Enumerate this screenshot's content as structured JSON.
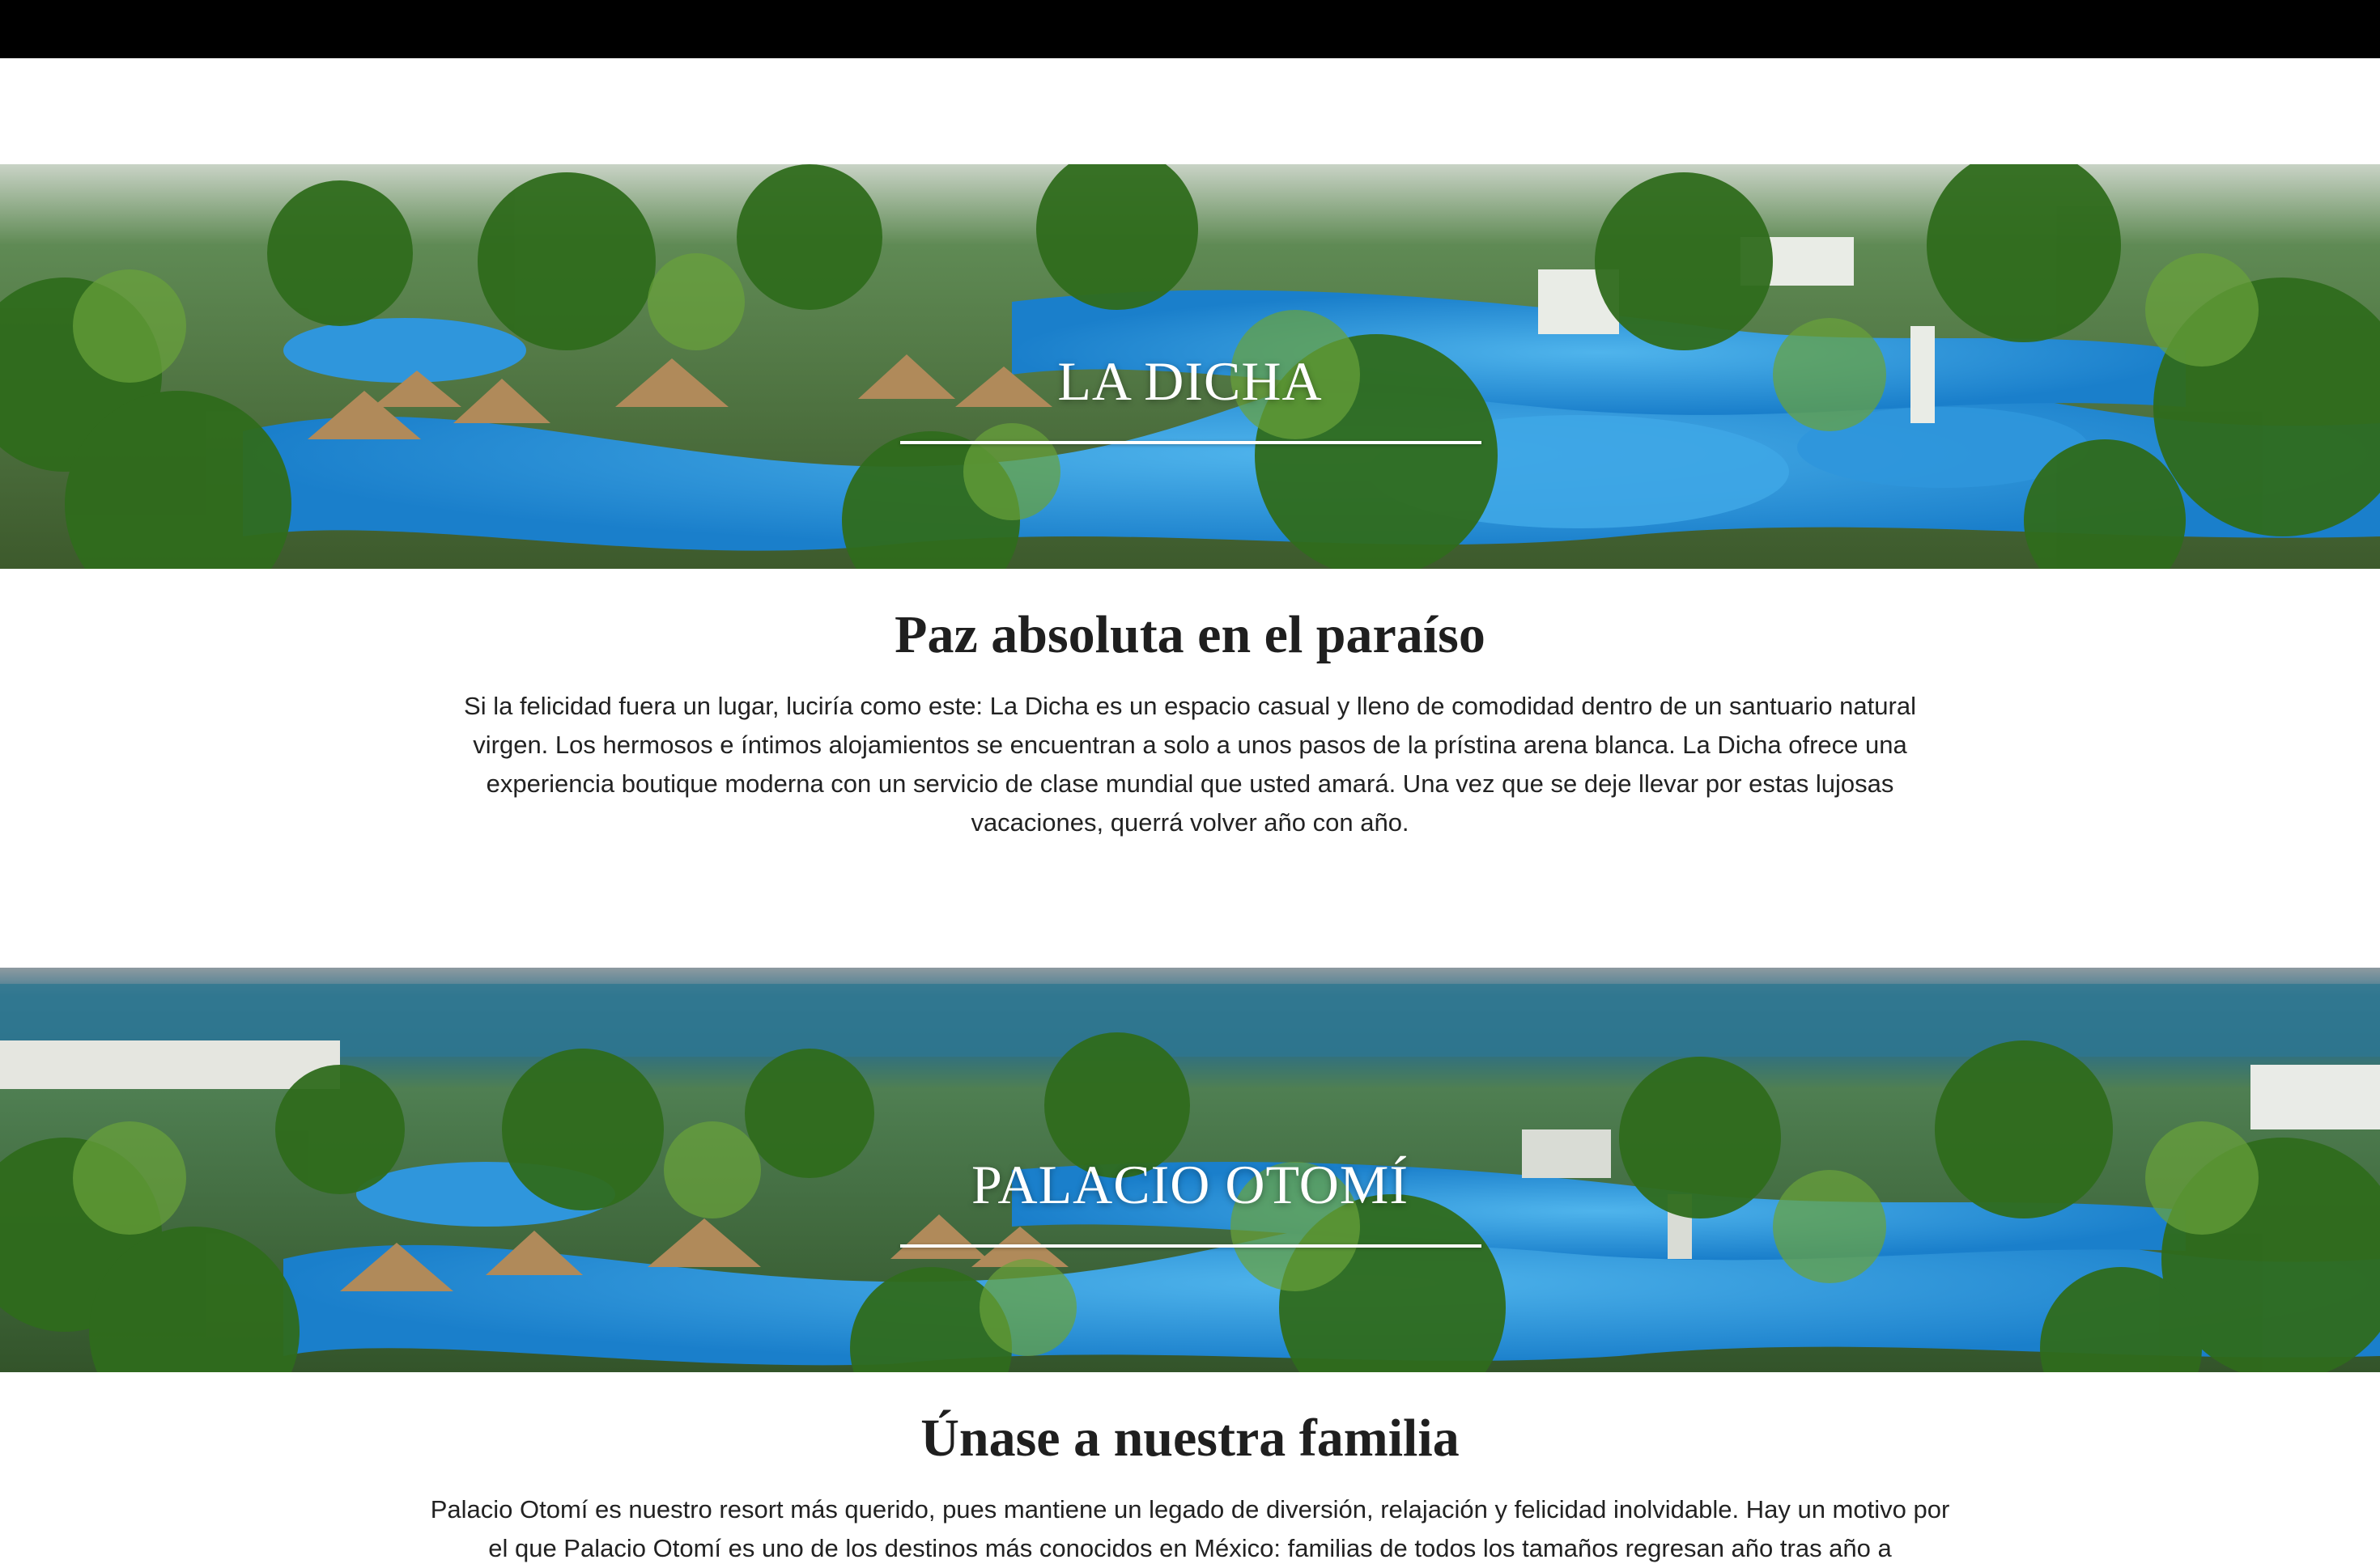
{
  "sections": [
    {
      "banner_title": "LA DICHA",
      "heading": "Paz absoluta en el paraíso",
      "body": "Si la felicidad fuera un lugar, luciría como este: La Dicha es un espacio casual y lleno de comodidad dentro de un santuario natural virgen. Los hermosos e íntimos alojamientos se encuentran a solo a unos pasos de la prístina arena blanca. La Dicha ofrece una experiencia boutique moderna con un servicio de clase mundial que usted amará. Una vez que se deje llevar por estas lujosas vacaciones, querrá volver año con año."
    },
    {
      "banner_title": "PALACIO OTOMÍ",
      "heading": "Únase a nuestra familia",
      "body": "Palacio Otomí es nuestro resort más querido, pues mantiene un legado de diversión, relajación y felicidad inolvidable. Hay un motivo por el que Palacio Otomí es uno de los destinos más conocidos en México: familias de todos los tamaños regresan año tras año a"
    }
  ],
  "colors": {
    "topbar": "#000000",
    "pool": "#1f8fd6",
    "palm": "#3f7a22",
    "sea": "#2c6e86"
  }
}
